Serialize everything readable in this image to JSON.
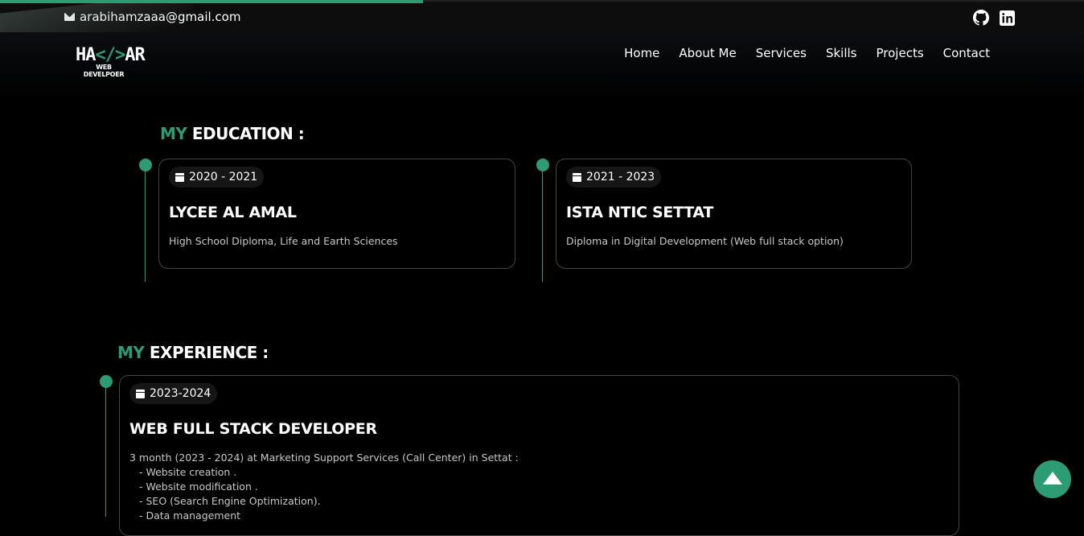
{
  "topbar": {
    "email": "arabihamzaaa@gmail.com",
    "icons": [
      "envelope-icon",
      "github-icon",
      "linkedin-icon"
    ]
  },
  "logo": {
    "text_left": "HA",
    "text_code": "</>",
    "text_right": "AR",
    "subtitle": "WEB DEVELPOER"
  },
  "nav": {
    "items": [
      "Home",
      "About Me",
      "Services",
      "Skills",
      "Projects",
      "Contact"
    ]
  },
  "education": {
    "heading_accent": "MY",
    "heading_rest": "EDUCATION :",
    "items": [
      {
        "date": "2020 - 2021",
        "title": "LYCEE AL AMAL",
        "description": "High School Diploma, Life and Earth Sciences"
      },
      {
        "date": "2021 - 2023",
        "title": "ISTA NTIC SETTAT",
        "description": "Diploma in Digital Development (Web full stack option)"
      }
    ]
  },
  "experience": {
    "heading_accent": "MY",
    "heading_rest": "EXPERIENCE :",
    "items": [
      {
        "date": "2023-2024",
        "title": "WEB FULL STACK DEVELOPER",
        "intro": "3 month (2023 - 2024) at Marketing Support Services (Call Center) in Settat :",
        "tasks": [
          "- Website creation .",
          "- Website modification .",
          "- SEO (Search Engine Optimization).",
          "- Data management"
        ]
      }
    ]
  },
  "colors": {
    "accent": "#2d9c74",
    "background": "#000000",
    "topbar": "#0d0d0d"
  },
  "scroll_progress": 0.39
}
